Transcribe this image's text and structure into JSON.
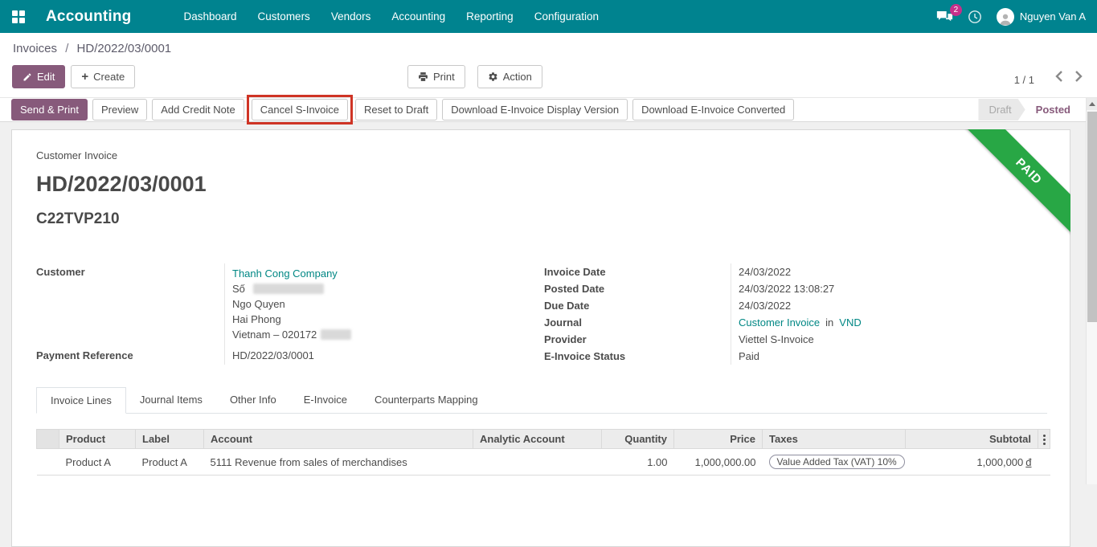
{
  "colors": {
    "topbar": "#00838f",
    "primary_button": "#875a7b",
    "link": "#008784",
    "paid_ribbon": "#28a745",
    "annotation_box": "#cf3425",
    "message_badge": "#c62f8a"
  },
  "nav": {
    "brand": "Accounting",
    "menus": [
      "Dashboard",
      "Customers",
      "Vendors",
      "Accounting",
      "Reporting",
      "Configuration"
    ],
    "message_badge": "2",
    "user_name": "Nguyen Van A"
  },
  "breadcrumb": {
    "parent": "Invoices",
    "separator": "/",
    "current": "HD/2022/03/0001"
  },
  "actions": {
    "edit": "Edit",
    "create": "Create",
    "print": "Print",
    "action": "Action",
    "pager": "1 / 1"
  },
  "statusbar": {
    "buttons": [
      {
        "label": "Send & Print"
      },
      {
        "label": "Preview"
      },
      {
        "label": "Add Credit Note"
      },
      {
        "label": "Cancel S-Invoice"
      },
      {
        "label": "Reset to Draft"
      },
      {
        "label": "Download E-Invoice Display Version"
      },
      {
        "label": "Download E-Invoice Converted"
      }
    ],
    "states": [
      {
        "label": "Draft"
      },
      {
        "label": "Posted"
      }
    ]
  },
  "invoice": {
    "type_label": "Customer Invoice",
    "number": "HD/2022/03/0001",
    "secondary_ref": "C22TVP210",
    "ribbon": "PAID",
    "customer_label": "Customer",
    "customer": {
      "name": "Thanh Cong Company",
      "street_prefix": "Số",
      "district": "Ngo Quyen",
      "city": "Hai Phong",
      "country_zip": "Vietnam – 020172"
    },
    "payment_reference_label": "Payment Reference",
    "payment_reference": "HD/2022/03/0001",
    "invoice_date_label": "Invoice Date",
    "invoice_date": "24/03/2022",
    "posted_date_label": "Posted Date",
    "posted_date": "24/03/2022 13:08:27",
    "due_date_label": "Due Date",
    "due_date": "24/03/2022",
    "journal_label": "Journal",
    "journal_name": "Customer Invoice",
    "journal_in": "in",
    "journal_currency": "VND",
    "provider_label": "Provider",
    "provider": "Viettel S-Invoice",
    "einvoice_status_label": "E-Invoice Status",
    "einvoice_status": "Paid"
  },
  "tabs": [
    {
      "label": "Invoice Lines"
    },
    {
      "label": "Journal Items"
    },
    {
      "label": "Other Info"
    },
    {
      "label": "E-Invoice"
    },
    {
      "label": "Counterparts Mapping"
    }
  ],
  "lines": {
    "headers": {
      "product": "Product",
      "label": "Label",
      "account": "Account",
      "analytic": "Analytic Account",
      "quantity": "Quantity",
      "price": "Price",
      "taxes": "Taxes",
      "subtotal": "Subtotal"
    },
    "rows": [
      {
        "product": "Product A",
        "label": "Product A",
        "account": "5111 Revenue from sales of merchandises",
        "analytic": "",
        "quantity": "1.00",
        "price": "1,000,000.00",
        "taxes": "Value Added Tax (VAT) 10%",
        "subtotal": "1,000,000",
        "currency": "đ"
      }
    ]
  }
}
